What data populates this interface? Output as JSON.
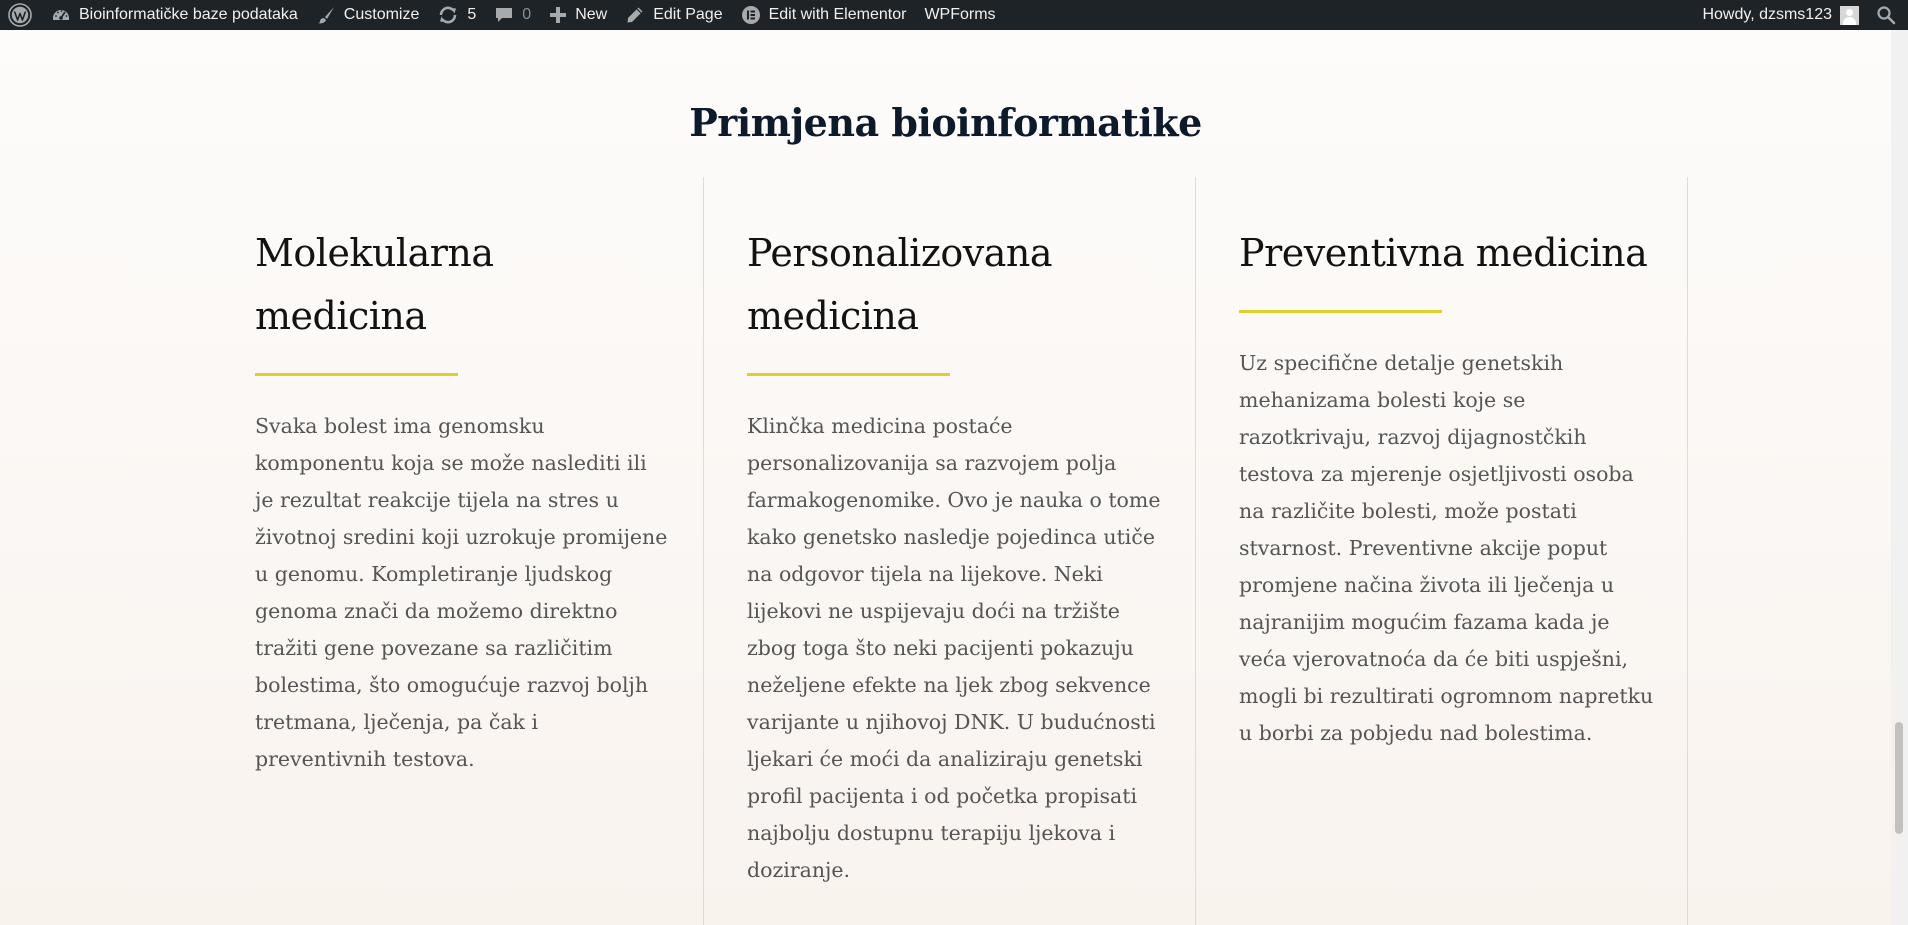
{
  "adminbar": {
    "site_name": "Bioinformatičke baze podataka",
    "customize": "Customize",
    "updates_count": "5",
    "comments_count": "0",
    "new": "New",
    "edit_page": "Edit Page",
    "edit_elementor": "Edit with Elementor",
    "wpforms": "WPForms",
    "howdy": "Howdy, dzsms123"
  },
  "section": {
    "title": "Primjena bioinformatike"
  },
  "columns": [
    {
      "title_line1": "Molekularna",
      "title_line2": "medicina",
      "text": "Svaka bolest ima genomsku komponentu koja se može naslediti ili je rezultat reakcije tijela na stres u životnoj sredini koji uzrokuje promijene u genomu. Kompletiranje ljudskog genoma znači da možemo direktno tražiti gene povezane sa različitim bolestima, što omogućuje razvoj boljh tretmana, lječenja, pa čak i preventivnih testova."
    },
    {
      "title_line1": "Personalizovana",
      "title_line2": "medicina",
      "text": "Klinčka medicina postaće personalizovanija sa razvojem polja farmakogenomike. Ovo je nauka o tome kako genetsko nasledje pojedinca utiče na odgovor tijela na lijekove. Neki lijekovi ne uspijevaju doći na tržište zbog toga što neki pacijenti pokazuju neželjene efekte na ljek zbog sekvence varijante u njihovoj DNK. U budućnosti ljekari će moći da analiziraju genetski profil pacijenta i od početka propisati najbolju dostupnu terapiju ljekova i doziranje."
    },
    {
      "title_line1": "Preventivna medicina",
      "text": "Uz specifične detalje genetskih mehanizama bolesti koje se razotkrivaju, razvoj dijagnostčkih testova za mjerenje osjetljivosti osoba na različite bolesti, može postati stvarnost. Preventivne akcije poput promjene načina života ili lječenja u najranijim mogućim fazama kada je veća vjerovatnoća da će biti uspješni, mogli bi rezultirati ogromnom napretku u borbi za pobjedu nad bolestima."
    }
  ],
  "colors": {
    "adminbar_bg": "#1d2327",
    "accent_underline": "#e0cd2e",
    "heading": "#0c1a2b",
    "body_text": "#555555"
  },
  "icons": [
    "wordpress-icon",
    "dashboard-icon",
    "brush-icon",
    "updates-icon",
    "comment-icon",
    "plus-icon",
    "pencil-icon",
    "elementor-icon",
    "avatar",
    "search-icon"
  ]
}
